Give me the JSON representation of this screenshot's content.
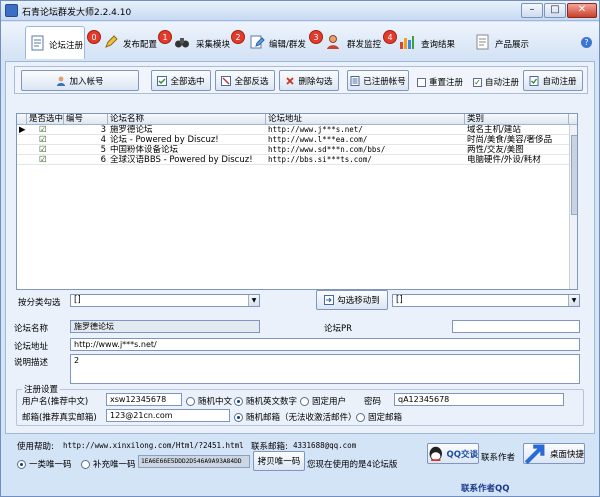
{
  "window": {
    "title": "石青论坛群发大师2.2.4.10",
    "minimize": "–",
    "maximize": "□",
    "close": "✕"
  },
  "tabs": [
    {
      "label": "论坛注册",
      "num": "0"
    },
    {
      "label": "发布配置",
      "num": "1"
    },
    {
      "label": "采集模块",
      "num": "2"
    },
    {
      "label": "编辑/群发",
      "num": "3"
    },
    {
      "label": "群发监控",
      "num": "4"
    },
    {
      "label": "查询结果",
      "num": ""
    },
    {
      "label": "产品展示",
      "num": ""
    }
  ],
  "help_label": "?",
  "toolbar": {
    "add_account": "加入帐号",
    "select_all": "全部选中",
    "invert_all": "全部反选",
    "delete_checked": "删除勾选",
    "registered_accounts": "已注册帐号",
    "re_register": "重置注册",
    "auto_register_chk": "自动注册",
    "auto_register_btn": "自动注册",
    "check_mark": "✓"
  },
  "table": {
    "headers": [
      "是否选中",
      "编号",
      "论坛名称",
      "论坛地址",
      "类别"
    ],
    "rows": [
      {
        "pointer": "▶",
        "checked": "☑",
        "id": "3",
        "name": "施罗德论坛",
        "url": "http://www.j***s.net/",
        "category": "域名主机/建站"
      },
      {
        "pointer": "",
        "checked": "☑",
        "id": "4",
        "name": "论坛 -  Powered by Discuz!",
        "url": "http://www.l***ea.com/",
        "category": "时尚/美食/美容/奢侈品"
      },
      {
        "pointer": "",
        "checked": "☑",
        "id": "5",
        "name": "中国粉体设备论坛",
        "url": "http://www.sd***n.com/bbs/",
        "category": "两性/交友/美图"
      },
      {
        "pointer": "",
        "checked": "☑",
        "id": "6",
        "name": "全球汉语BBS  - Powered by Discuz!",
        "url": "http://bbs.si***ts.com/",
        "category": "电脑硬件/外设/耗材"
      }
    ]
  },
  "classify": {
    "label": "按分类勾选",
    "value": "[]",
    "move_button": "勾选移动到",
    "target_value": "[]"
  },
  "detail": {
    "name_label": "论坛名称",
    "name_value": "施罗德论坛",
    "pr_label": "论坛PR",
    "pr_value": "",
    "url_label": "论坛地址",
    "url_value": "http://www.j***s.net/",
    "desc_label": "说明描述",
    "desc_value": "2"
  },
  "register": {
    "legend": "注册设置",
    "username_label": "用户名(推荐中文)",
    "username_value": "xsw12345678",
    "random_cn": "随机中文",
    "random_en": "随机英文数字",
    "fixed_user": "固定用户",
    "password_label": "密码",
    "password_value": "qA12345678",
    "email_label": "邮箱(推荐真实邮箱)",
    "email_value": "123@21cn.com",
    "random_email": "随机邮箱（无法收激活邮件）",
    "fixed_email": "固定邮箱"
  },
  "footer": {
    "help_label": "使用帮助:",
    "help_url": "http://www.xinxilong.com/Html/?2451.html",
    "contact_label": "联系邮箱:",
    "contact_value": "4331688@qq.com",
    "one_machine_code": "一类唯一码",
    "supplement_code": "补充唯一码",
    "machine_code": "1EA6E66E5DDD2D546A9A93A84DD",
    "copy_code": "拷贝唯一码",
    "using_status": "您现在使用的是4论坛版",
    "qq_talk": "QQ交谈",
    "contact_author": "联系作者",
    "desktop_shortcut": "桌面快捷",
    "author_qq": "联系作者QQ"
  },
  "colors": {
    "accent": "#3a6fc4",
    "badge": "#e33b2b",
    "panel": "#eaf1fa"
  }
}
